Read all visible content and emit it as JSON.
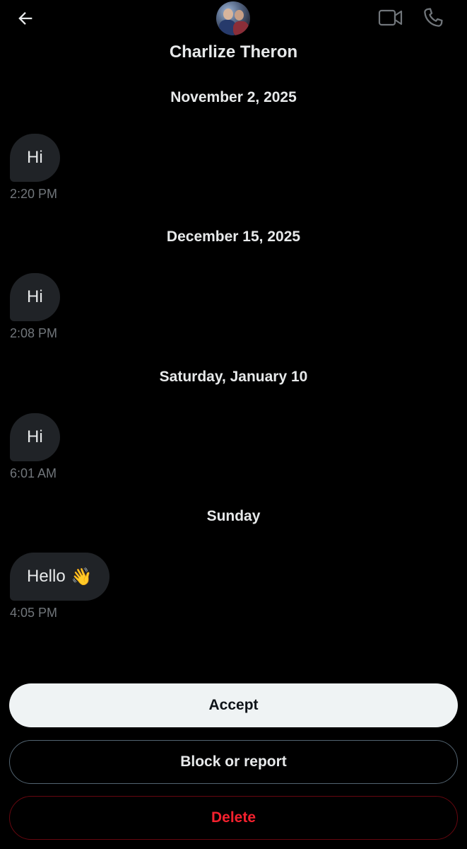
{
  "header": {
    "contact_name": "Charlize Theron",
    "icons": {
      "back": "arrow-left-icon",
      "video": "video-camera-icon",
      "phone": "phone-icon"
    }
  },
  "conversation": [
    {
      "date": "November 2, 2025",
      "message": "Hi",
      "time": "2:20 PM"
    },
    {
      "date": "December 15, 2025",
      "message": "Hi",
      "time": "2:08 PM"
    },
    {
      "date": "Saturday, January 10",
      "message": "Hi",
      "time": "6:01 AM"
    },
    {
      "date": "Sunday",
      "message": "Hello",
      "emoji": "👋",
      "time": "4:05 PM"
    }
  ],
  "actions": {
    "accept": "Accept",
    "block": "Block or report",
    "delete": "Delete"
  },
  "colors": {
    "background": "#000000",
    "bubble": "#202327",
    "accept_bg": "#eff3f4",
    "delete_red": "#f4212e",
    "muted_text": "#71767b"
  }
}
